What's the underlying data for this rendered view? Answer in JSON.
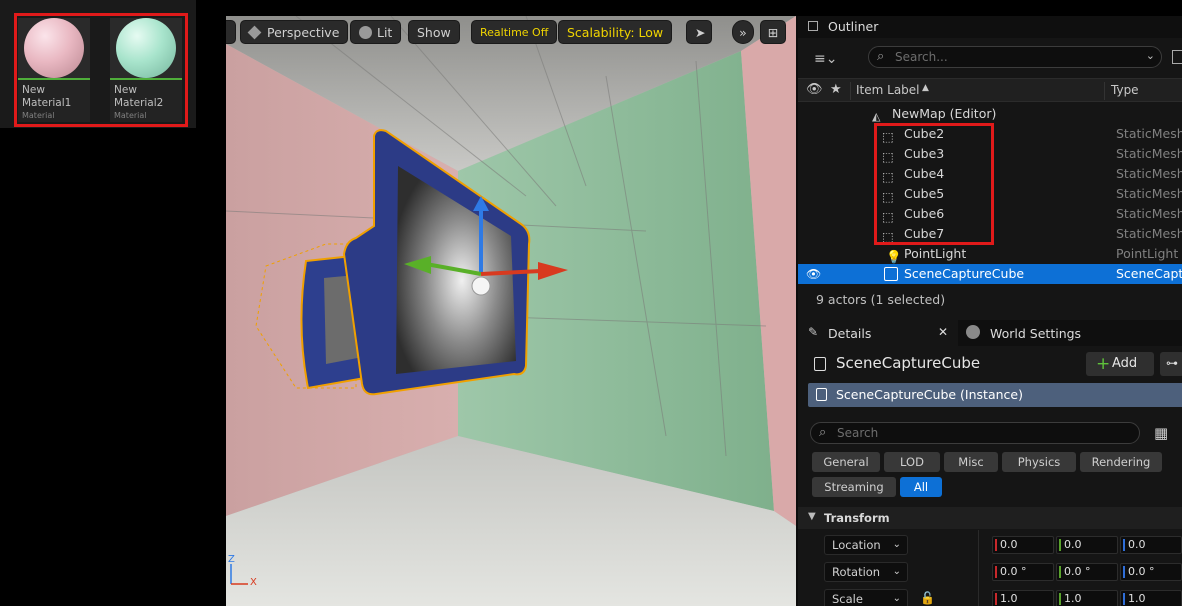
{
  "content_browser": {
    "assets": [
      {
        "name": "New Material1",
        "type": "Material",
        "color": "#e9b8c2"
      },
      {
        "name": "New Material2",
        "type": "Material",
        "color": "#a8e4cc"
      }
    ]
  },
  "viewport": {
    "toolbar": {
      "perspective": "Perspective",
      "lit": "Lit",
      "show": "Show",
      "realtime": "Realtime Off",
      "scalability": "Scalability: Low"
    },
    "axis": {
      "z": "Z",
      "x": "X"
    }
  },
  "outliner": {
    "tab_title": "Outliner",
    "search_placeholder": "Search...",
    "columns": {
      "label": "Item Label",
      "type": "Type"
    },
    "rows": [
      {
        "name": "NewMap (Editor)",
        "type": "",
        "icon": "map-icon"
      },
      {
        "name": "Cube2",
        "type": "StaticMeshA",
        "icon": "static-mesh-icon"
      },
      {
        "name": "Cube3",
        "type": "StaticMeshA",
        "icon": "static-mesh-icon"
      },
      {
        "name": "Cube4",
        "type": "StaticMeshA",
        "icon": "static-mesh-icon"
      },
      {
        "name": "Cube5",
        "type": "StaticMeshA",
        "icon": "static-mesh-icon"
      },
      {
        "name": "Cube6",
        "type": "StaticMeshA",
        "icon": "static-mesh-icon"
      },
      {
        "name": "Cube7",
        "type": "StaticMeshA",
        "icon": "static-mesh-icon"
      },
      {
        "name": "PointLight",
        "type": "PointLight",
        "icon": "light-bulb-icon"
      },
      {
        "name": "SceneCaptureCube",
        "type": "SceneCaptu",
        "icon": "scene-capture-icon",
        "selected": true
      }
    ],
    "status": "9 actors (1 selected)"
  },
  "details": {
    "tab_details": "Details",
    "tab_world_settings": "World Settings",
    "object_name": "SceneCaptureCube",
    "add_label": "Add",
    "instance_label": "SceneCaptureCube (Instance)",
    "search_placeholder": "Search",
    "filters_row1": [
      "General",
      "LOD",
      "Misc",
      "Physics",
      "Rendering"
    ],
    "filters_row2": [
      "Streaming",
      "All"
    ],
    "section": "Transform",
    "transform": {
      "location": {
        "label": "Location",
        "x": "0.0",
        "y": "0.0",
        "z": "0.0"
      },
      "rotation": {
        "label": "Rotation",
        "x": "0.0 °",
        "y": "0.0 °",
        "z": "0.0 °"
      },
      "scale": {
        "label": "Scale",
        "x": "1.0",
        "y": "1.0",
        "z": "1.0"
      }
    }
  }
}
